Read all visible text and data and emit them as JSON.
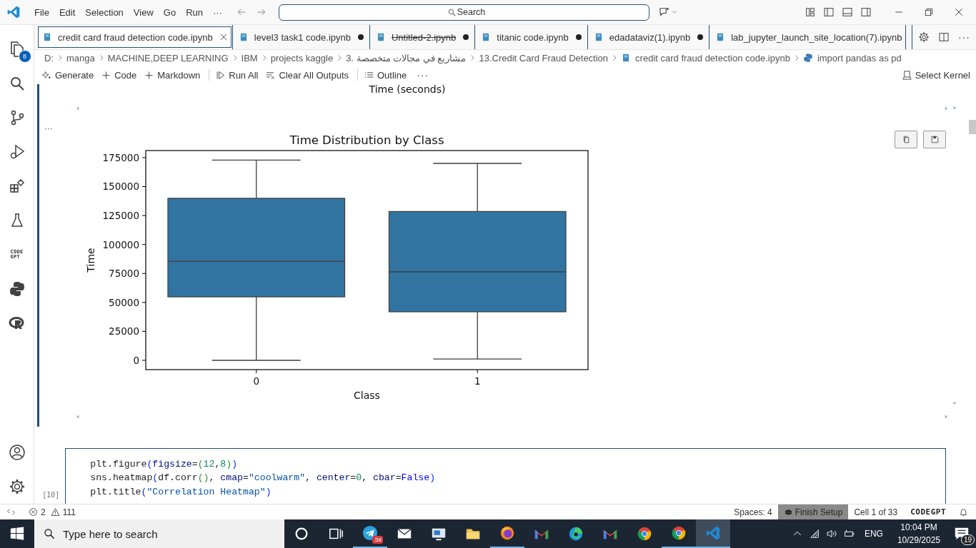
{
  "title_bar": {
    "menu": [
      "File",
      "Edit",
      "Selection",
      "View",
      "Go",
      "Run",
      "···"
    ],
    "search": {
      "placeholder": "Search"
    }
  },
  "activity_bar": {
    "explorer_badge": "8",
    "codegpt_logo": [
      "CODE",
      "GPT"
    ]
  },
  "tabs": [
    {
      "label": "credit card fraud detection code.ipynb",
      "selected": true,
      "dirty": false,
      "deleted": false
    },
    {
      "label": "level3 task1 code.ipynb",
      "selected": false,
      "dirty": true,
      "deleted": false
    },
    {
      "label": "Untitled-2.ipynb",
      "selected": false,
      "dirty": true,
      "deleted": true
    },
    {
      "label": "titanic code.ipynb",
      "selected": false,
      "dirty": true,
      "deleted": false
    },
    {
      "label": "edadataviz(1).ipynb",
      "selected": false,
      "dirty": true,
      "deleted": false
    },
    {
      "label": "lab_jupyter_launch_site_location(7).ipynb",
      "selected": false,
      "dirty": false,
      "deleted": false
    }
  ],
  "breadcrumb": [
    {
      "label": "D:",
      "kind": "folder"
    },
    {
      "label": "manga",
      "kind": "folder"
    },
    {
      "label": "MACHINE,DEEP LEARNING",
      "kind": "folder"
    },
    {
      "label": "IBM",
      "kind": "folder"
    },
    {
      "label": "projects kaggle",
      "kind": "folder"
    },
    {
      "label": "3. مشاريع في مجالات متخصصة",
      "kind": "folder"
    },
    {
      "label": "13.Credit Card Fraud Detection",
      "kind": "folder"
    },
    {
      "label": "credit card fraud detection  code.ipynb",
      "kind": "notebook"
    },
    {
      "label": "import pandas as pd",
      "kind": "python"
    }
  ],
  "toolbar": {
    "items": [
      {
        "label": "Generate",
        "kind": "generate"
      },
      {
        "label": "Code",
        "kind": "add"
      },
      {
        "label": "Markdown",
        "kind": "add"
      },
      {
        "label": "Run All",
        "kind": "run"
      },
      {
        "label": "Clear All Outputs",
        "kind": "clear"
      },
      {
        "label": "Outline",
        "kind": "outline"
      }
    ],
    "kernel": "Select Kernel"
  },
  "output": {
    "previous_xlabel": "Time (seconds)",
    "chart_data": {
      "type": "box",
      "title": "Time Distribution by Class",
      "xlabel": "Class",
      "ylabel": "Time",
      "categories": [
        "0",
        "1"
      ],
      "ylim": [
        -8000,
        181100
      ],
      "yticks": [
        0,
        25000,
        50000,
        75000,
        100000,
        125000,
        150000,
        175000
      ]
    }
  },
  "code_cell": {
    "execution_count": "[10]",
    "lines": [
      [
        {
          "kind": "plain",
          "text": "plt.figure"
        },
        {
          "kind": "bracket1",
          "text": "("
        },
        {
          "kind": "param",
          "text": "figsize"
        },
        {
          "kind": "plain",
          "text": "="
        },
        {
          "kind": "bracket2",
          "text": "("
        },
        {
          "kind": "number",
          "text": "12"
        },
        {
          "kind": "plain",
          "text": ","
        },
        {
          "kind": "number",
          "text": "8"
        },
        {
          "kind": "bracket2",
          "text": ")"
        },
        {
          "kind": "bracket1",
          "text": ")"
        }
      ],
      [
        {
          "kind": "plain",
          "text": "sns.heatmap"
        },
        {
          "kind": "bracket1",
          "text": "("
        },
        {
          "kind": "plain",
          "text": "df.corr"
        },
        {
          "kind": "bracket2",
          "text": "()"
        },
        {
          "kind": "plain",
          "text": ", "
        },
        {
          "kind": "param",
          "text": "cmap"
        },
        {
          "kind": "plain",
          "text": "="
        },
        {
          "kind": "string",
          "text": "\"coolwarm\""
        },
        {
          "kind": "plain",
          "text": ", "
        },
        {
          "kind": "param",
          "text": "center"
        },
        {
          "kind": "plain",
          "text": "="
        },
        {
          "kind": "number",
          "text": "0"
        },
        {
          "kind": "plain",
          "text": ", "
        },
        {
          "kind": "param",
          "text": "cbar"
        },
        {
          "kind": "plain",
          "text": "="
        },
        {
          "kind": "keyword",
          "text": "False"
        },
        {
          "kind": "bracket1",
          "text": ")"
        }
      ],
      [
        {
          "kind": "plain",
          "text": "plt.title"
        },
        {
          "kind": "bracket1",
          "text": "("
        },
        {
          "kind": "string",
          "text": "\"Correlation Heatmap\""
        },
        {
          "kind": "bracket1",
          "text": ")"
        }
      ]
    ]
  },
  "status_bar": {
    "errors": "2",
    "warnings": "111",
    "items": [
      {
        "label": "Spaces: 4",
        "highlighted": false
      },
      {
        "label": "Finish Setup",
        "highlighted": true
      },
      {
        "label": "Cell 1 of 33",
        "highlighted": false
      }
    ],
    "brand": "CODEGPT"
  },
  "taskbar": {
    "search_placeholder": "Type here to search",
    "apps": [
      {
        "kind": "cortana",
        "running": false,
        "active": false
      },
      {
        "kind": "taskview",
        "running": false,
        "active": false
      },
      {
        "kind": "telegram",
        "badge": ".58",
        "running": true,
        "active": false
      },
      {
        "kind": "mail",
        "running": false,
        "active": false
      },
      {
        "kind": "screen",
        "running": false,
        "active": false
      },
      {
        "kind": "folder",
        "running": false,
        "active": false
      },
      {
        "kind": "firefox",
        "running": true,
        "active": false
      },
      {
        "kind": "gmail",
        "running": false,
        "active": false
      },
      {
        "kind": "edge",
        "running": false,
        "active": false
      },
      {
        "kind": "gmail",
        "running": false,
        "active": false
      },
      {
        "kind": "chrome",
        "running": false,
        "active": false
      },
      {
        "kind": "chrome",
        "running": true,
        "active": false
      },
      {
        "kind": "vscode",
        "running": true,
        "active": true
      }
    ],
    "language": "ENG",
    "time": "10:04 PM",
    "date": "10/29/2025",
    "notifications": "19"
  }
}
